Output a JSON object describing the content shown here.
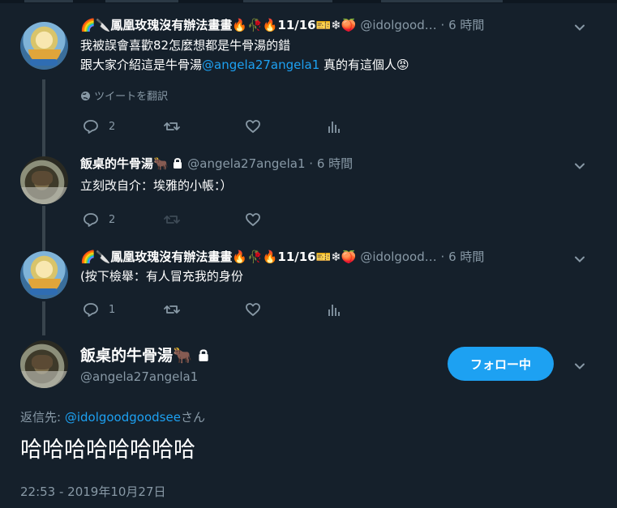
{
  "tweets": [
    {
      "name": "🌈🔪鳳凰玫瑰沒有辦法畫畫🔥🥀🔥11/16🎫❄🍑",
      "handle": "@idolgood…",
      "dot": "·",
      "time": "6 時間",
      "line1": "我被誤會喜歡82怎麼想都是牛骨湯的錯",
      "line2_prefix": "跟大家介紹這是牛骨湯",
      "line2_mention": "@angela27angela1",
      "line2_suffix": " 真的有這個人😡",
      "translate": "ツイートを翻訳",
      "reply_count": "2"
    },
    {
      "name": "飯桌的牛骨湯🐂",
      "handle": "@angela27angela1",
      "dot": "·",
      "time": "6 時間",
      "line1": "立刻改自介：埃雅的小帳：）",
      "reply_count": "2"
    },
    {
      "name": "🌈🔪鳳凰玫瑰沒有辦法畫畫🔥🥀🔥11/16🎫❄🍑",
      "handle": "@idolgood…",
      "dot": "·",
      "time": "6 時間",
      "line1": "(按下檢舉：有人冒充我的身份",
      "reply_count": "1"
    }
  ],
  "main": {
    "name": "飯桌的牛骨湯🐂",
    "handle": "@angela27angela1",
    "follow_label": "フォロー中",
    "reply_prefix": "返信先: ",
    "reply_mention": "@idolgoodgoodsee",
    "reply_suffix": "さん",
    "text": "哈哈哈哈哈哈哈哈",
    "timestamp": "22:53 - 2019年10月27日"
  },
  "icons": [
    "reply-icon",
    "retweet-icon",
    "like-icon",
    "analytics-icon",
    "lock-icon",
    "chevron-down-icon",
    "globe-icon"
  ],
  "colors": {
    "background": "#15202b",
    "accent": "#1da1f2",
    "muted": "#8899a6",
    "thread": "#38444d"
  }
}
